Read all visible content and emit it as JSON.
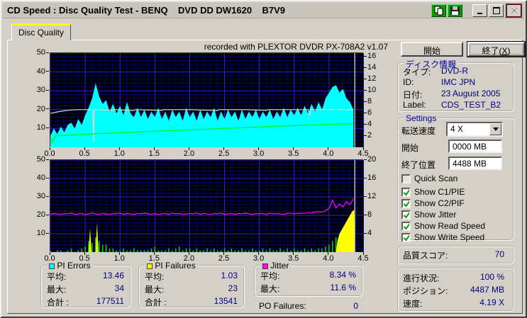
{
  "window": {
    "title": "CD Speed : Disc Quality Test - BENQ    DVD DD DW1620    B7V9",
    "titlebar_buttons": [
      {
        "name": "copy"
      },
      {
        "name": "save"
      },
      {
        "name": "minimize"
      },
      {
        "name": "maximize"
      },
      {
        "name": "close"
      }
    ]
  },
  "tab": {
    "label": "Disc Quality"
  },
  "chart_header": "recorded with PLEXTOR DVDR   PX-708A2   v1.07",
  "chart_data": [
    {
      "name": "pi-errors-graph",
      "type": "area",
      "position": "top",
      "x_range": [
        0,
        4.5
      ],
      "x_ticks": [
        "0.0",
        "0.5",
        "1.0",
        "1.5",
        "2.0",
        "2.5",
        "3.0",
        "3.5",
        "4.0",
        "4.5"
      ],
      "left_axis": {
        "max": 50,
        "ticks": [
          10,
          20,
          30,
          40,
          50
        ]
      },
      "right_axis": {
        "max": 16.67,
        "ticks": [
          2,
          4,
          6,
          8,
          10,
          12,
          14,
          16
        ]
      },
      "grid": {
        "major_x": 0.5,
        "minor_x": 0.1,
        "major_y": 10,
        "minor_y": 2,
        "major_color": "#2222DD",
        "minor_color": "#000078"
      },
      "background": "#000000",
      "series": [
        {
          "name": "pi-errors",
          "label": "PI Errors",
          "style": "area",
          "color": "#00FFFF",
          "axis": "left",
          "x0": 0,
          "dx": 0.05,
          "y": [
            6,
            10,
            7,
            11,
            8,
            12,
            13,
            10,
            15,
            12,
            17,
            21,
            26,
            34,
            27,
            23,
            25,
            19,
            23,
            18,
            22,
            17,
            24,
            18,
            16,
            21,
            16,
            20,
            15,
            19,
            16,
            21,
            15,
            19,
            14,
            20,
            16,
            19,
            14,
            21,
            16,
            19,
            14,
            20,
            15,
            19,
            16,
            21,
            14,
            19,
            15,
            20,
            16,
            19,
            14,
            20,
            15,
            19,
            16,
            20,
            15,
            19,
            16,
            20,
            15,
            19,
            16,
            21,
            16,
            20,
            17,
            21,
            17,
            22,
            18,
            23,
            19,
            24,
            20,
            26,
            29,
            32,
            33,
            29,
            31,
            26,
            24,
            20
          ]
        },
        {
          "name": "write-speed",
          "label": "Write Speed",
          "style": "line",
          "color": "#D8D8D8",
          "axis": "left",
          "points": [
            [
              0,
              18
            ],
            [
              0.1,
              18.8
            ],
            [
              0.2,
              19.4
            ],
            [
              0.3,
              19.8
            ],
            [
              0.4,
              20
            ],
            [
              0.6,
              20
            ],
            [
              0.61,
              20
            ],
            [
              0.62,
              3
            ],
            [
              0.63,
              20
            ],
            [
              0.9,
              19.6
            ],
            [
              0.92,
              20
            ],
            [
              1.2,
              19.5
            ],
            [
              1.22,
              20
            ],
            [
              1.6,
              19.6
            ],
            [
              1.62,
              20
            ],
            [
              2.0,
              20
            ],
            [
              2.4,
              19.5
            ],
            [
              2.42,
              20
            ],
            [
              2.8,
              20
            ],
            [
              3.1,
              19.6
            ],
            [
              3.12,
              20
            ],
            [
              3.5,
              20
            ],
            [
              3.7,
              20
            ],
            [
              3.72,
              17
            ],
            [
              3.74,
              20
            ],
            [
              4.0,
              20
            ],
            [
              4.2,
              20
            ],
            [
              4.3,
              19.8
            ],
            [
              4.35,
              20
            ]
          ]
        },
        {
          "name": "read-speed",
          "label": "Read Speed",
          "style": "line",
          "color": "#00EE00",
          "axis": "right",
          "points": [
            [
              0,
              1.9
            ],
            [
              0.03,
              0.8
            ],
            [
              0.07,
              2.0
            ],
            [
              0.5,
              2.3
            ],
            [
              1.0,
              2.6
            ],
            [
              1.5,
              2.85
            ],
            [
              2.0,
              3.1
            ],
            [
              2.5,
              3.35
            ],
            [
              3.0,
              3.6
            ],
            [
              3.5,
              3.85
            ],
            [
              4.0,
              4.05
            ],
            [
              4.35,
              4.19
            ]
          ]
        },
        {
          "name": "end-marker",
          "style": "vline",
          "color": "#BBBBBB",
          "x": 4.37
        }
      ]
    },
    {
      "name": "pif-jitter-graph",
      "type": "area",
      "position": "bottom",
      "x_range": [
        0,
        4.5
      ],
      "x_ticks": [
        "0.0",
        "0.5",
        "1.0",
        "1.5",
        "2.0",
        "2.5",
        "3.0",
        "3.5",
        "4.0",
        "4.5"
      ],
      "left_axis": {
        "max": 50,
        "ticks": [
          10,
          20,
          30,
          40,
          50
        ]
      },
      "right_axis": {
        "max": 20,
        "ticks": [
          4,
          8,
          12,
          16,
          20
        ]
      },
      "grid": {
        "major_x": 0.5,
        "minor_x": 0.1,
        "major_y": 10,
        "minor_y": 2,
        "major_color": "#2222DD",
        "minor_color": "#000078"
      },
      "background": "#000000",
      "series": [
        {
          "name": "pi-failures-green",
          "label": "PI Failures",
          "style": "spikes",
          "color": "#00DD00",
          "axis": "left",
          "x0": 0,
          "dx": 0.05,
          "y": [
            1,
            0,
            1,
            1,
            0,
            1,
            2,
            0,
            1,
            2,
            3,
            6,
            5,
            8,
            6,
            4,
            4,
            2,
            2,
            1,
            1,
            2,
            1,
            1,
            2,
            1,
            1,
            1,
            1,
            2,
            3,
            1,
            1,
            1,
            2,
            1,
            2,
            3,
            1,
            2,
            2,
            1,
            2,
            1,
            1,
            2,
            1,
            2,
            1,
            1,
            2,
            1,
            2,
            1,
            1,
            2,
            1,
            1,
            2,
            1,
            1,
            2,
            1,
            2,
            1,
            1,
            2,
            1,
            2,
            1,
            2,
            1,
            1,
            2,
            1,
            2,
            1,
            2,
            2,
            3,
            4,
            6,
            8,
            7,
            0,
            0,
            0,
            0
          ]
        },
        {
          "name": "pi-failures-yellow",
          "label": "PI Failures (end)",
          "style": "area",
          "color": "#FFFF00",
          "axis": "left",
          "points": [
            [
              0.55,
              0
            ],
            [
              0.57,
              13
            ],
            [
              0.59,
              0
            ],
            [
              0.65,
              0
            ],
            [
              0.67,
              16
            ],
            [
              0.69,
              0
            ],
            [
              4.1,
              0
            ],
            [
              4.12,
              6
            ],
            [
              4.15,
              10
            ],
            [
              4.18,
              12
            ],
            [
              4.21,
              14
            ],
            [
              4.24,
              16
            ],
            [
              4.27,
              18
            ],
            [
              4.3,
              20
            ],
            [
              4.33,
              22
            ],
            [
              4.36,
              23
            ],
            [
              4.37,
              0
            ]
          ]
        },
        {
          "name": "jitter",
          "label": "Jitter",
          "style": "line",
          "color": "#FF00FF",
          "axis": "right",
          "x0": 0,
          "dx": 0.05,
          "y": [
            8.2,
            8.4,
            8.3,
            8.2,
            8.4,
            8.3,
            8.5,
            8.2,
            8.3,
            8.4,
            8.2,
            8.3,
            8.5,
            8.3,
            8.2,
            8.4,
            8.3,
            8.2,
            8.4,
            8.3,
            8.5,
            8.2,
            8.4,
            8.3,
            8.2,
            8.4,
            8.3,
            8.5,
            8.3,
            8.2,
            8.4,
            8.2,
            8.3,
            8.4,
            8.2,
            8.5,
            8.3,
            8.4,
            8.2,
            8.3,
            8.4,
            8.3,
            8.5,
            8.2,
            8.4,
            8.3,
            8.2,
            8.4,
            8.3,
            8.5,
            8.2,
            8.3,
            8.4,
            8.2,
            8.4,
            8.3,
            8.5,
            8.3,
            8.2,
            8.4,
            8.3,
            8.4,
            8.2,
            8.5,
            8.3,
            8.4,
            8.3,
            8.2,
            8.4,
            8.5,
            8.3,
            8.4,
            8.5,
            8.4,
            8.6,
            8.5,
            8.7,
            8.8,
            8.7,
            9.0,
            9.5,
            11.3,
            9.6,
            10.5,
            9.8,
            11.0,
            10.3,
            11.6
          ]
        },
        {
          "name": "end-marker",
          "style": "vline",
          "color": "#BBBBBB",
          "x": 4.37
        }
      ]
    }
  ],
  "right_panel": {
    "start_button": "開始",
    "exit_button": {
      "prefix": "終了(",
      "accelerator": "X",
      "suffix": ")"
    },
    "disc_info": {
      "title": "ディスク情報",
      "rows": [
        {
          "label": "タイプ:",
          "value": "DVD-R"
        },
        {
          "label": "ID:",
          "value": "IMC JPN"
        },
        {
          "label": "日付:",
          "value": "23 August 2005"
        },
        {
          "label": "Label:",
          "value": "CDS_TEST_B2"
        }
      ]
    },
    "settings": {
      "title": "Settings",
      "speed_label": "転送速度",
      "speed_value": "4 X",
      "start_label": "開始",
      "start_value": "0000 MB",
      "end_label": "終了位置",
      "end_value": "4488 MB",
      "checkboxes": [
        {
          "label": "Quick Scan",
          "checked": false
        },
        {
          "label": "Show C1/PIE",
          "checked": true
        },
        {
          "label": "Show C2/PIF",
          "checked": true
        },
        {
          "label": "Show Jitter",
          "checked": true
        },
        {
          "label": "Show Read Speed",
          "checked": true
        },
        {
          "label": "Show Write Speed",
          "checked": true
        }
      ],
      "check_color": "#00A000"
    },
    "quality": {
      "label": "品質スコア:",
      "value": "70"
    },
    "progress": {
      "rows": [
        {
          "label": "進行状況:",
          "value": "100 %"
        },
        {
          "label": "ポジション:",
          "value": "4487 MB"
        },
        {
          "label": "速度:",
          "value": "4.19 X"
        }
      ]
    }
  },
  "stats": {
    "pi_errors": {
      "title": "PI Errors",
      "color": "#00FFFF",
      "rows": [
        {
          "label": "平均:",
          "value": "13.46"
        },
        {
          "label": "最大:",
          "value": "34"
        },
        {
          "label": "合計 :",
          "value": "177511"
        }
      ]
    },
    "pi_failures": {
      "title": "PI Failures",
      "color": "#FFFF00",
      "rows": [
        {
          "label": "平均:",
          "value": "1.03"
        },
        {
          "label": "最大:",
          "value": "23"
        },
        {
          "label": "合計 :",
          "value": "13541"
        }
      ]
    },
    "jitter": {
      "title": "Jitter",
      "color": "#FF00FF",
      "rows": [
        {
          "label": "平均:",
          "value": "8.34 %"
        },
        {
          "label": "最大:",
          "value": "11.6 %"
        }
      ]
    },
    "po_failures": {
      "label": "PO Failures:",
      "value": "0"
    }
  }
}
